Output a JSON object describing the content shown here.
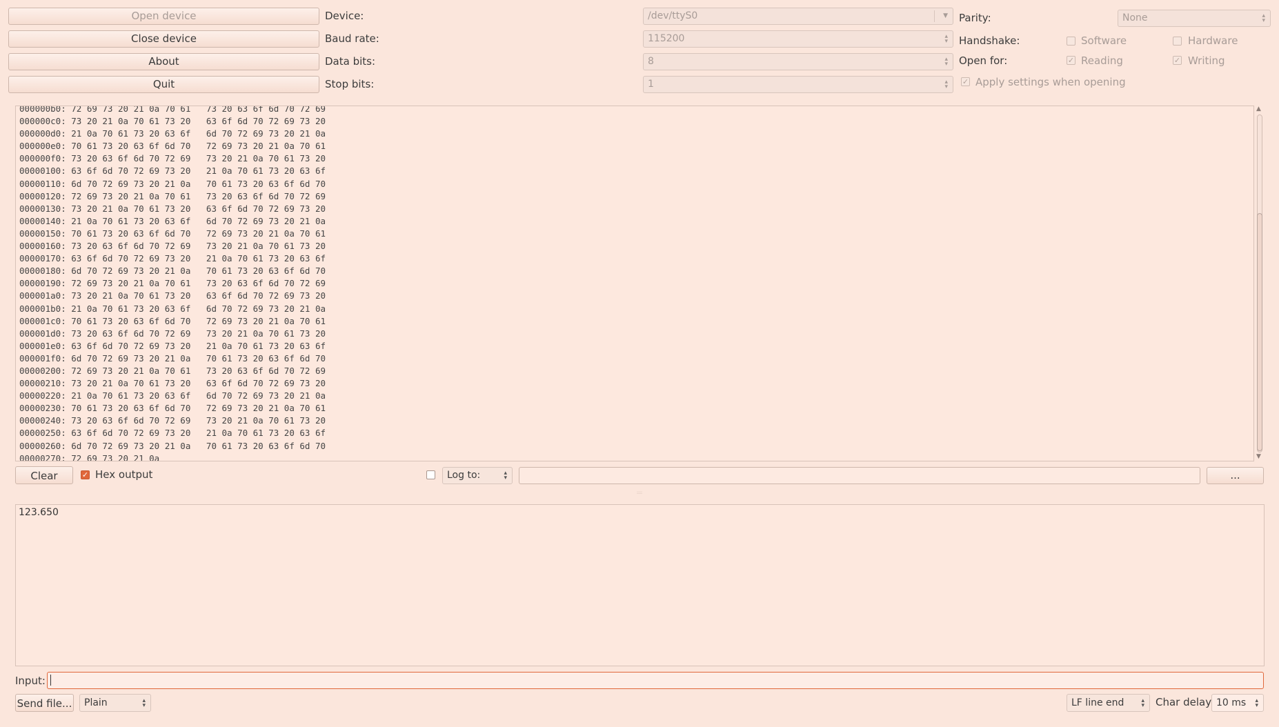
{
  "toolbar": {
    "open_device": "Open device",
    "close_device": "Close device",
    "about": "About",
    "quit": "Quit"
  },
  "settings": {
    "device_label": "Device:",
    "device_value": "/dev/ttyS0",
    "baud_label": "Baud rate:",
    "baud_value": "115200",
    "databits_label": "Data bits:",
    "databits_value": "8",
    "stopbits_label": "Stop bits:",
    "stopbits_value": "1",
    "parity_label": "Parity:",
    "parity_value": "None",
    "handshake_label": "Handshake:",
    "software_label": "Software",
    "hardware_label": "Hardware",
    "openfor_label": "Open for:",
    "reading_label": "Reading",
    "writing_label": "Writing",
    "apply_label": "Apply settings when opening"
  },
  "output": {
    "partial_line": "000000b0: 72 69 73 20 21 0a 70 61   73 20 63 6f 6d 70 72 69",
    "lines": [
      "000000c0: 73 20 21 0a 70 61 73 20   63 6f 6d 70 72 69 73 20",
      "000000d0: 21 0a 70 61 73 20 63 6f   6d 70 72 69 73 20 21 0a",
      "000000e0: 70 61 73 20 63 6f 6d 70   72 69 73 20 21 0a 70 61",
      "000000f0: 73 20 63 6f 6d 70 72 69   73 20 21 0a 70 61 73 20",
      "00000100: 63 6f 6d 70 72 69 73 20   21 0a 70 61 73 20 63 6f",
      "00000110: 6d 70 72 69 73 20 21 0a   70 61 73 20 63 6f 6d 70",
      "00000120: 72 69 73 20 21 0a 70 61   73 20 63 6f 6d 70 72 69",
      "00000130: 73 20 21 0a 70 61 73 20   63 6f 6d 70 72 69 73 20",
      "00000140: 21 0a 70 61 73 20 63 6f   6d 70 72 69 73 20 21 0a",
      "00000150: 70 61 73 20 63 6f 6d 70   72 69 73 20 21 0a 70 61",
      "00000160: 73 20 63 6f 6d 70 72 69   73 20 21 0a 70 61 73 20",
      "00000170: 63 6f 6d 70 72 69 73 20   21 0a 70 61 73 20 63 6f",
      "00000180: 6d 70 72 69 73 20 21 0a   70 61 73 20 63 6f 6d 70",
      "00000190: 72 69 73 20 21 0a 70 61   73 20 63 6f 6d 70 72 69",
      "000001a0: 73 20 21 0a 70 61 73 20   63 6f 6d 70 72 69 73 20",
      "000001b0: 21 0a 70 61 73 20 63 6f   6d 70 72 69 73 20 21 0a",
      "000001c0: 70 61 73 20 63 6f 6d 70   72 69 73 20 21 0a 70 61",
      "000001d0: 73 20 63 6f 6d 70 72 69   73 20 21 0a 70 61 73 20",
      "000001e0: 63 6f 6d 70 72 69 73 20   21 0a 70 61 73 20 63 6f",
      "000001f0: 6d 70 72 69 73 20 21 0a   70 61 73 20 63 6f 6d 70",
      "00000200: 72 69 73 20 21 0a 70 61   73 20 63 6f 6d 70 72 69",
      "00000210: 73 20 21 0a 70 61 73 20   63 6f 6d 70 72 69 73 20",
      "00000220: 21 0a 70 61 73 20 63 6f   6d 70 72 69 73 20 21 0a",
      "00000230: 70 61 73 20 63 6f 6d 70   72 69 73 20 21 0a 70 61",
      "00000240: 73 20 63 6f 6d 70 72 69   73 20 21 0a 70 61 73 20",
      "00000250: 63 6f 6d 70 72 69 73 20   21 0a 70 61 73 20 63 6f",
      "00000260: 6d 70 72 69 73 20 21 0a   70 61 73 20 63 6f 6d 70",
      "00000270: 72 69 73 20 21 0a"
    ]
  },
  "controls": {
    "clear": "Clear",
    "hex_output": "Hex output",
    "log_to": "Log to:",
    "browse": "...",
    "log_path": ""
  },
  "send_area": {
    "text": "123.650"
  },
  "input": {
    "label": "Input:",
    "value": ""
  },
  "bottom": {
    "send_file": "Send file...",
    "mode": "Plain",
    "line_end": "LF line end",
    "char_delay_label": "Char delay:",
    "char_delay_value": "10 ms"
  },
  "colors": {
    "background": "#fbe6dc",
    "accent": "#e0673a"
  }
}
